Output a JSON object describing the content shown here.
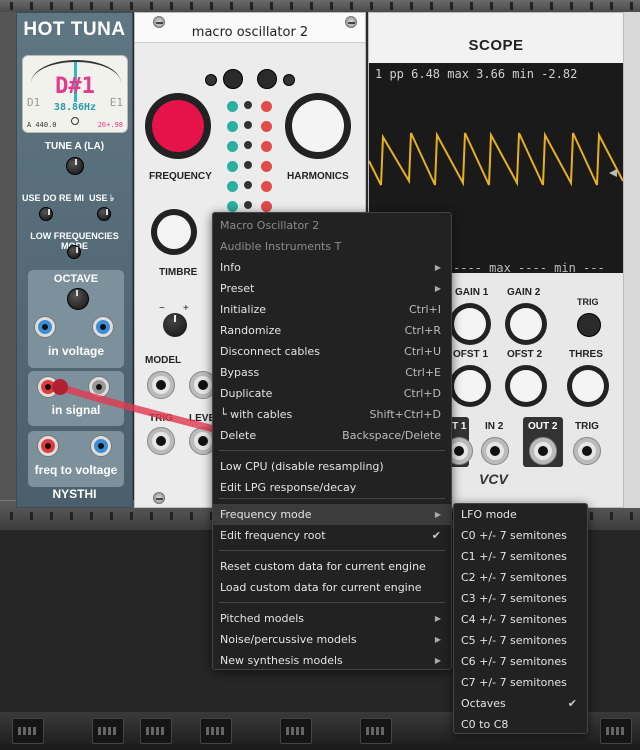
{
  "colors": {
    "menu_bg": "#222222",
    "menu_highlight": "#3c3c3c",
    "scope_wave": "#e8b020",
    "freq_knob": "#e6134a",
    "cable": "#e23a50"
  },
  "hottuna": {
    "title": "HOT TUNA",
    "note": "D#1",
    "prev_note": "D1",
    "next_note": "E1",
    "freq": "38.86Hz",
    "ref": "A 440.0",
    "cents": "26+.98",
    "tune_label": "TUNE A (LA)",
    "use_do_re_mi": "USE DO RE MI",
    "use_flat": "USE ♭",
    "low_freq_mode": "LOW FREQUENCIES MODE",
    "octave_label": "OCTAVE",
    "in_voltage": "in voltage",
    "in_signal": "in signal",
    "freq_to_voltage": "freq to voltage",
    "brand": "NYSTHI"
  },
  "macro": {
    "title": "macro oscillator 2",
    "frequency": "FREQUENCY",
    "harmonics": "HARMONICS",
    "timbre": "TIMBRE",
    "model": "MODEL",
    "trig": "TRIG",
    "level": "LEVEL",
    "minus": "−",
    "plus": "+"
  },
  "scope": {
    "title": "SCOPE",
    "stats": "1  pp   6.48 max  3.66 min -2.82",
    "stats2": "---- max  ---- min  ---",
    "gain1": "GAIN 1",
    "gain2": "GAIN 2",
    "ofst1": "OFST 1",
    "ofst2": "OFST 2",
    "trig": "TRIG",
    "thres": "THRES",
    "in1": "T 1",
    "in2": "IN 2",
    "out2": "OUT 2",
    "trig_in": "TRIG",
    "logo": "VCV"
  },
  "menu": {
    "items": [
      {
        "label": "Macro Oscillator 2",
        "disabled": true
      },
      {
        "label": "Audible Instruments T",
        "disabled": true
      },
      {
        "label": "Info",
        "arrow": "▶"
      },
      {
        "label": "Preset",
        "arrow": "▶"
      },
      {
        "label": "Initialize",
        "shortcut": "Ctrl+I"
      },
      {
        "label": "Randomize",
        "shortcut": "Ctrl+R"
      },
      {
        "label": "Disconnect cables",
        "shortcut": "Ctrl+U"
      },
      {
        "label": "Bypass",
        "shortcut": "Ctrl+E"
      },
      {
        "label": "Duplicate",
        "shortcut": "Ctrl+D"
      },
      {
        "label": "└ with cables",
        "shortcut": "Shift+Ctrl+D"
      },
      {
        "label": "Delete",
        "shortcut": "Backspace/Delete"
      },
      {
        "label": "Low CPU (disable resampling)"
      },
      {
        "label": "Edit LPG response/decay"
      },
      {
        "label": "Frequency mode",
        "arrow": "▶",
        "highlighted": true
      },
      {
        "label": "Edit frequency root",
        "check": "✔"
      },
      {
        "label": "Reset custom data for current engine"
      },
      {
        "label": "Load custom data for current engine"
      },
      {
        "label": "Pitched models",
        "arrow": "▶"
      },
      {
        "label": "Noise/percussive models",
        "arrow": "▶"
      },
      {
        "label": "New synthesis models",
        "arrow": "▶"
      }
    ]
  },
  "submenu": {
    "items": [
      {
        "label": "LFO mode"
      },
      {
        "label": "C0 +/- 7 semitones"
      },
      {
        "label": "C1 +/- 7 semitones"
      },
      {
        "label": "C2 +/- 7 semitones"
      },
      {
        "label": "C3 +/- 7 semitones"
      },
      {
        "label": "C4 +/- 7 semitones"
      },
      {
        "label": "C5 +/- 7 semitones"
      },
      {
        "label": "C6 +/- 7 semitones"
      },
      {
        "label": "C7 +/- 7 semitones"
      },
      {
        "label": "Octaves",
        "check": "✔"
      },
      {
        "label": "C0 to C8"
      }
    ]
  }
}
